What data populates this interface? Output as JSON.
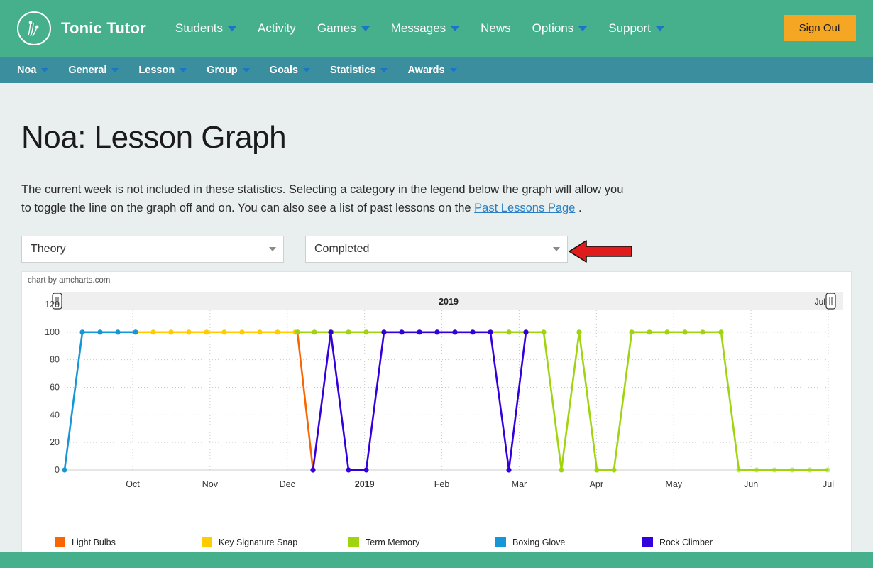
{
  "topnav": {
    "brand": "Tonic Tutor",
    "logo_icon": "tonic-tutor-logo",
    "items": [
      {
        "label": "Students",
        "caret": true
      },
      {
        "label": "Activity",
        "caret": false
      },
      {
        "label": "Games",
        "caret": true
      },
      {
        "label": "Messages",
        "caret": true
      },
      {
        "label": "News",
        "caret": false
      },
      {
        "label": "Options",
        "caret": true
      },
      {
        "label": "Support",
        "caret": true
      }
    ],
    "sign_out": "Sign Out",
    "bg_color": "#45B08B",
    "button_color": "#F5A623"
  },
  "subnav": {
    "bg_color": "#3B8E9E",
    "items": [
      {
        "label": "Noa",
        "caret": true
      },
      {
        "label": "General",
        "caret": true
      },
      {
        "label": "Lesson",
        "caret": true
      },
      {
        "label": "Group",
        "caret": true
      },
      {
        "label": "Goals",
        "caret": true
      },
      {
        "label": "Statistics",
        "caret": true
      },
      {
        "label": "Awards",
        "caret": true
      }
    ]
  },
  "main": {
    "title": "Noa: Lesson Graph",
    "intro_part1": "The current week is not included in these statistics. Selecting a category in the legend below the graph will allow you to toggle the line on the graph off and on. You can also see a list of past lessons on the ",
    "intro_link": "Past Lessons Page",
    "intro_part2": " .",
    "select_category": {
      "value": "Theory",
      "placeholder": "Theory"
    },
    "select_status": {
      "value": "Completed",
      "placeholder": "Completed"
    },
    "annotation_arrow": "red-left-arrow"
  },
  "chart_data": {
    "type": "line",
    "title": "",
    "credit": "chart by amcharts.com",
    "scrollbar": {
      "left_label": "",
      "center_label": "2019",
      "right_label": "Jul"
    },
    "xlabel": "",
    "ylabel": "",
    "ylim": [
      0,
      120
    ],
    "yticks": [
      0,
      20,
      40,
      60,
      80,
      100,
      120
    ],
    "xticks": [
      "Oct",
      "Nov",
      "Dec",
      "2019",
      "Feb",
      "Mar",
      "Apr",
      "May",
      "Jun",
      "Jul"
    ],
    "xtick_bold": [
      "2019"
    ],
    "grid": true,
    "legend_position": "bottom",
    "series": [
      {
        "name": "Light Bulbs",
        "color": "#F96500",
        "points": [
          [
            418,
            100
          ],
          [
            440,
            0
          ]
        ]
      },
      {
        "name": "Key Signature Snap",
        "color": "#FFCC00",
        "points": [
          [
            190,
            100
          ],
          [
            215,
            100
          ],
          [
            240,
            100
          ],
          [
            265,
            100
          ],
          [
            290,
            100
          ],
          [
            315,
            100
          ],
          [
            340,
            100
          ],
          [
            365,
            100
          ],
          [
            390,
            100
          ],
          [
            415,
            100
          ]
        ]
      },
      {
        "name": "Term Memory",
        "color": "#9FD40E",
        "points": [
          [
            418,
            100
          ],
          [
            442,
            100
          ],
          [
            466,
            100
          ],
          [
            490,
            100
          ],
          [
            515,
            100
          ],
          [
            540,
            100
          ],
          [
            565,
            100
          ],
          [
            590,
            100
          ],
          [
            615,
            100
          ],
          [
            640,
            100
          ],
          [
            665,
            100
          ],
          [
            690,
            100
          ],
          [
            716,
            100
          ],
          [
            740,
            100
          ],
          [
            765,
            100
          ],
          [
            790,
            0
          ],
          [
            815,
            100
          ],
          [
            840,
            0
          ],
          [
            864,
            0
          ],
          [
            889,
            100
          ],
          [
            914,
            100
          ],
          [
            939,
            100
          ],
          [
            964,
            100
          ],
          [
            989,
            100
          ],
          [
            1015,
            100
          ],
          [
            1040,
            0
          ],
          [
            1065,
            0
          ],
          [
            1090,
            0
          ],
          [
            1115,
            0
          ],
          [
            1140,
            0
          ],
          [
            1165,
            0
          ]
        ]
      },
      {
        "name": "Boxing Glove",
        "color": "#1596D7",
        "points": [
          [
            90,
            0
          ],
          [
            115,
            100
          ],
          [
            140,
            100
          ],
          [
            165,
            100
          ],
          [
            190,
            100
          ]
        ]
      },
      {
        "name": "Rock Climber",
        "color": "#3300DD",
        "points": [
          [
            440,
            0
          ],
          [
            465,
            100
          ],
          [
            490,
            0
          ],
          [
            515,
            0
          ],
          [
            540,
            100
          ],
          [
            565,
            100
          ],
          [
            590,
            100
          ],
          [
            615,
            100
          ],
          [
            640,
            100
          ],
          [
            665,
            100
          ],
          [
            690,
            100
          ],
          [
            716,
            0
          ],
          [
            740,
            100
          ]
        ]
      }
    ]
  }
}
